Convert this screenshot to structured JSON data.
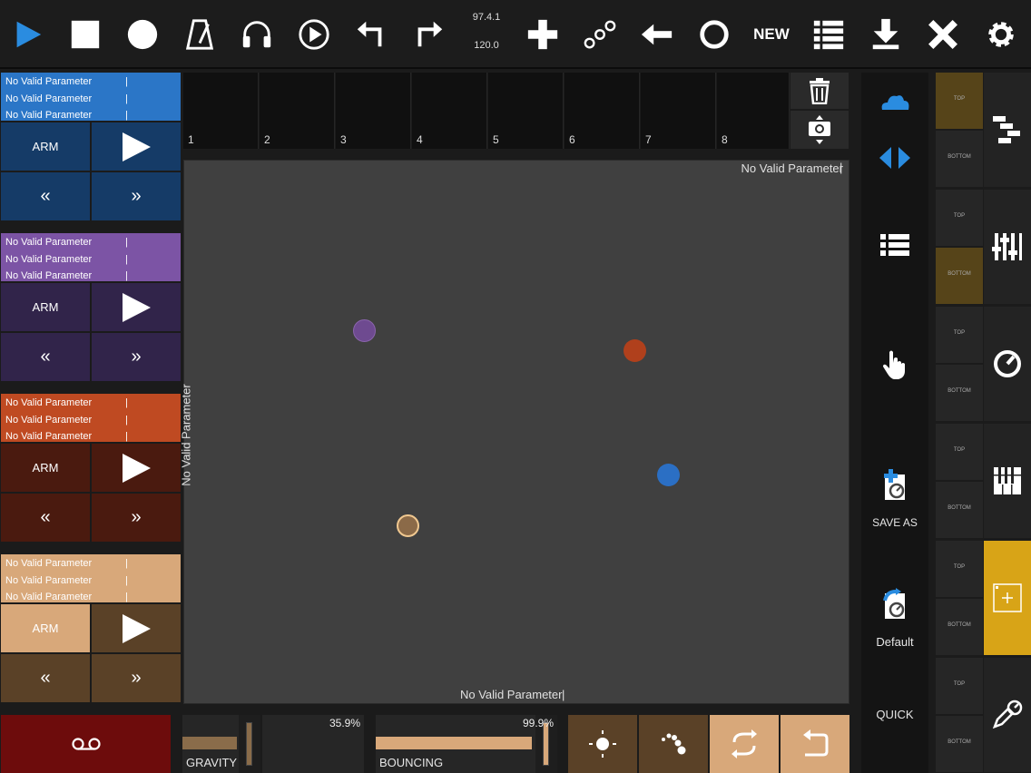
{
  "toolbar": {
    "tempo_top": "97.4.1",
    "tempo_bottom": "120.0",
    "new_label": "NEW",
    "accent": "#2a8ce0"
  },
  "tracks": [
    {
      "color": "#2b76c7",
      "dark": "#153b67",
      "params": [
        "No Valid Parameter",
        "No Valid Parameter",
        "No Valid Parameter"
      ],
      "arm": "ARM",
      "rew": "«",
      "ff": "»"
    },
    {
      "color": "#7c54a5",
      "dark": "#31244a",
      "params": [
        "No Valid Parameter",
        "No Valid Parameter",
        "No Valid Parameter"
      ],
      "arm": "ARM",
      "rew": "«",
      "ff": "»"
    },
    {
      "color": "#bf4a22",
      "dark": "#4a1a0f",
      "params": [
        "No Valid Parameter",
        "No Valid Parameter",
        "No Valid Parameter"
      ],
      "arm": "ARM",
      "rew": "«",
      "ff": "»"
    },
    {
      "color": "#d8a87a",
      "dark": "#5a4127",
      "params": [
        "No Valid Parameter",
        "No Valid Parameter",
        "No Valid Parameter"
      ],
      "arm": "ARM",
      "rew": "«",
      "ff": "»"
    }
  ],
  "steps": [
    "1",
    "2",
    "3",
    "4",
    "5",
    "6",
    "7",
    "8"
  ],
  "pad": {
    "x_label": "No Valid Parameter",
    "y_label": "No Valid Parameter",
    "top_right_label": "No Valid Parameter"
  },
  "side": {
    "save_as": "SAVE AS",
    "default": "Default",
    "quick": "QUICK"
  },
  "panes": [
    {
      "top": "TOP",
      "bottom": "BOTTOM"
    },
    {
      "top": "TOP",
      "bottom": "BOTTOM"
    },
    {
      "top": "TOP",
      "bottom": "BOTTOM"
    },
    {
      "top": "TOP",
      "bottom": "BOTTOM"
    },
    {
      "top": "TOP",
      "bottom": "BOTTOM"
    },
    {
      "top": "TOP",
      "bottom": "BOTTOM"
    }
  ],
  "bottom": {
    "gravity_label": "GRAVITY",
    "gravity_value": "35.9%",
    "gravity_fraction": 0.359,
    "bouncing_label": "BOUNCING",
    "bouncing_value": "99.9%",
    "bouncing_fraction": 0.999
  }
}
